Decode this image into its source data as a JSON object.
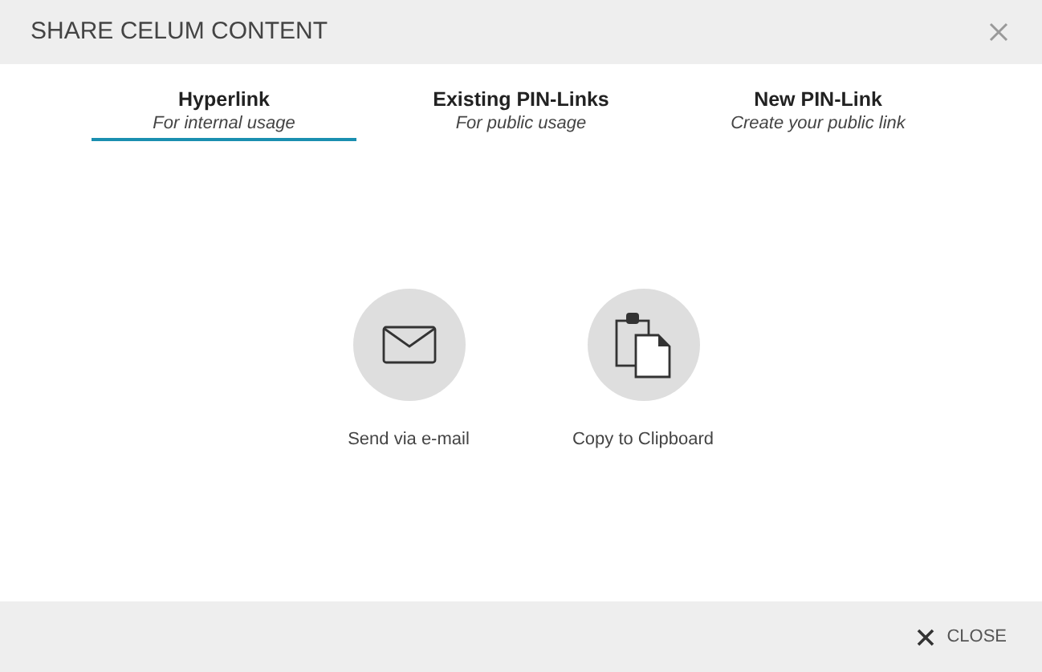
{
  "window": {
    "title": "SHARE CELUM CONTENT"
  },
  "tabs": [
    {
      "label": "Hyperlink",
      "subtitle": "For internal usage",
      "selected": true
    },
    {
      "label": "Existing PIN-Links",
      "subtitle": "For public usage",
      "selected": false
    },
    {
      "label": "New PIN-Link",
      "subtitle": "Create your public link",
      "selected": false
    }
  ],
  "actions": [
    {
      "kind": "email",
      "label": "Send via e-mail"
    },
    {
      "kind": "clipboard",
      "label": "Copy to Clipboard"
    }
  ],
  "footer": {
    "close_button": "CLOSE"
  }
}
